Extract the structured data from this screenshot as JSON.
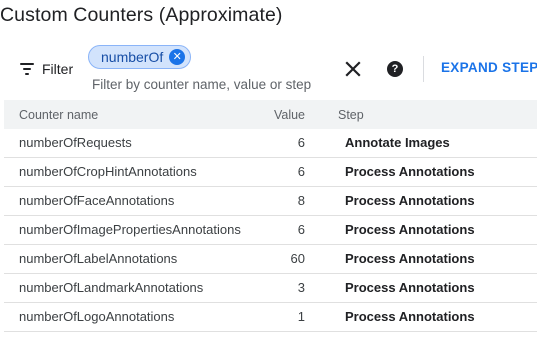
{
  "page": {
    "title": "Custom Counters (Approximate)"
  },
  "filter": {
    "button_label": "Filter",
    "chip_label": "numberOf",
    "hint": "Filter by counter name, value or step",
    "help_glyph": "?",
    "expand_label": "EXPAND STEPS"
  },
  "table": {
    "headers": {
      "name": "Counter name",
      "value": "Value",
      "step": "Step"
    },
    "rows": [
      {
        "name": "numberOfRequests",
        "value": "6",
        "step": "Annotate Images"
      },
      {
        "name": "numberOfCropHintAnnotations",
        "value": "6",
        "step": "Process Annotations"
      },
      {
        "name": "numberOfFaceAnnotations",
        "value": "8",
        "step": "Process Annotations"
      },
      {
        "name": "numberOfImagePropertiesAnnotations",
        "value": "6",
        "step": "Process Annotations"
      },
      {
        "name": "numberOfLabelAnnotations",
        "value": "60",
        "step": "Process Annotations"
      },
      {
        "name": "numberOfLandmarkAnnotations",
        "value": "3",
        "step": "Process Annotations"
      },
      {
        "name": "numberOfLogoAnnotations",
        "value": "1",
        "step": "Process Annotations"
      }
    ]
  },
  "colors": {
    "accent": "#1a73e8",
    "chip_background": "#d2e3fc",
    "header_background": "#f1f3f4"
  },
  "icons": {
    "filter": "filter-list-icon",
    "chip_close": "cancel-circle-icon",
    "clear": "close-icon",
    "help": "help-circle-icon"
  }
}
